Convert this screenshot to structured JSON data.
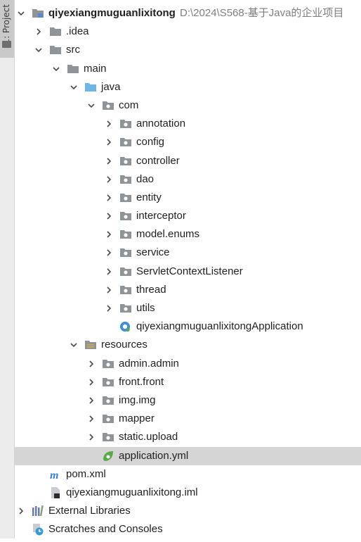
{
  "side_panel": {
    "tab_label": "1: Project"
  },
  "tree": [
    {
      "label": "qiyexiangmuguanlixitong",
      "path": "D:\\2024\\S568-基于Java的企业项目",
      "indent": 0,
      "arrow": "down",
      "icon": "module-folder-icon",
      "bold": true
    },
    {
      "label": ".idea",
      "indent": 1,
      "arrow": "right",
      "icon": "folder-icon"
    },
    {
      "label": "src",
      "indent": 1,
      "arrow": "down",
      "icon": "folder-icon"
    },
    {
      "label": "main",
      "indent": 2,
      "arrow": "down",
      "icon": "folder-icon"
    },
    {
      "label": "java",
      "indent": 3,
      "arrow": "down",
      "icon": "source-folder-icon"
    },
    {
      "label": "com",
      "indent": 4,
      "arrow": "down",
      "icon": "package-icon"
    },
    {
      "label": "annotation",
      "indent": 5,
      "arrow": "right",
      "icon": "package-icon"
    },
    {
      "label": "config",
      "indent": 5,
      "arrow": "right",
      "icon": "package-icon"
    },
    {
      "label": "controller",
      "indent": 5,
      "arrow": "right",
      "icon": "package-icon"
    },
    {
      "label": "dao",
      "indent": 5,
      "arrow": "right",
      "icon": "package-icon"
    },
    {
      "label": "entity",
      "indent": 5,
      "arrow": "right",
      "icon": "package-icon"
    },
    {
      "label": "interceptor",
      "indent": 5,
      "arrow": "right",
      "icon": "package-icon"
    },
    {
      "label": "model.enums",
      "indent": 5,
      "arrow": "right",
      "icon": "package-icon"
    },
    {
      "label": "service",
      "indent": 5,
      "arrow": "right",
      "icon": "package-icon"
    },
    {
      "label": "ServletContextListener",
      "indent": 5,
      "arrow": "right",
      "icon": "package-icon"
    },
    {
      "label": "thread",
      "indent": 5,
      "arrow": "right",
      "icon": "package-icon"
    },
    {
      "label": "utils",
      "indent": 5,
      "arrow": "right",
      "icon": "package-icon"
    },
    {
      "label": "qiyexiangmuguanlixitongApplication",
      "indent": 5,
      "arrow": "none",
      "icon": "spring-app-class-icon"
    },
    {
      "label": "resources",
      "indent": 3,
      "arrow": "down",
      "icon": "resources-folder-icon"
    },
    {
      "label": "admin.admin",
      "indent": 4,
      "arrow": "right",
      "icon": "package-icon"
    },
    {
      "label": "front.front",
      "indent": 4,
      "arrow": "right",
      "icon": "package-icon"
    },
    {
      "label": "img.img",
      "indent": 4,
      "arrow": "right",
      "icon": "package-icon"
    },
    {
      "label": "mapper",
      "indent": 4,
      "arrow": "right",
      "icon": "package-icon"
    },
    {
      "label": "static.upload",
      "indent": 4,
      "arrow": "right",
      "icon": "package-icon"
    },
    {
      "label": "application.yml",
      "indent": 4,
      "arrow": "none",
      "icon": "spring-config-icon",
      "selected": true
    },
    {
      "label": "pom.xml",
      "indent": 1,
      "arrow": "none",
      "icon": "maven-icon"
    },
    {
      "label": "qiyexiangmuguanlixitong.iml",
      "indent": 1,
      "arrow": "none",
      "icon": "iml-file-icon"
    },
    {
      "label": "External Libraries",
      "indent": 0,
      "arrow": "right",
      "icon": "libraries-icon"
    },
    {
      "label": "Scratches and Consoles",
      "indent": 0,
      "arrow": "none",
      "icon": "scratches-icon"
    }
  ],
  "colors": {
    "folder": "#8f9499",
    "source_folder": "#6fb6e6",
    "spring_green": "#5aa84a",
    "maven_blue": "#3d7fd1",
    "selected_row": "#d5d5d5"
  }
}
